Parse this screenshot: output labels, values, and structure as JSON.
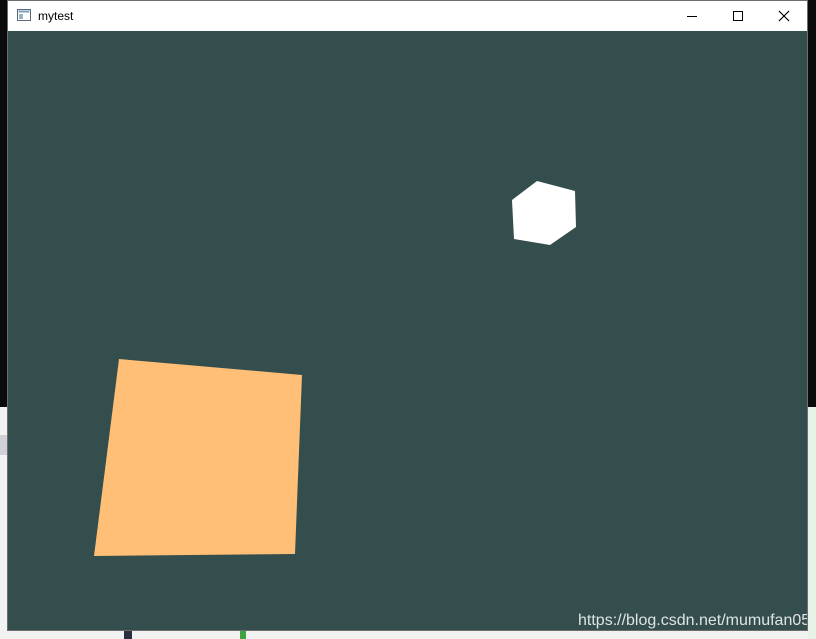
{
  "window": {
    "title": "mytest",
    "controls": {
      "minimize": "minimize",
      "maximize": "maximize",
      "close": "close"
    }
  },
  "viewport": {
    "background": "#344d4d",
    "objects": [
      {
        "name": "white-cube",
        "color": "#ffffff"
      },
      {
        "name": "orange-quad",
        "color": "#ffbf76"
      }
    ]
  },
  "watermark": "https://blog.csdn.net/mumufan05"
}
